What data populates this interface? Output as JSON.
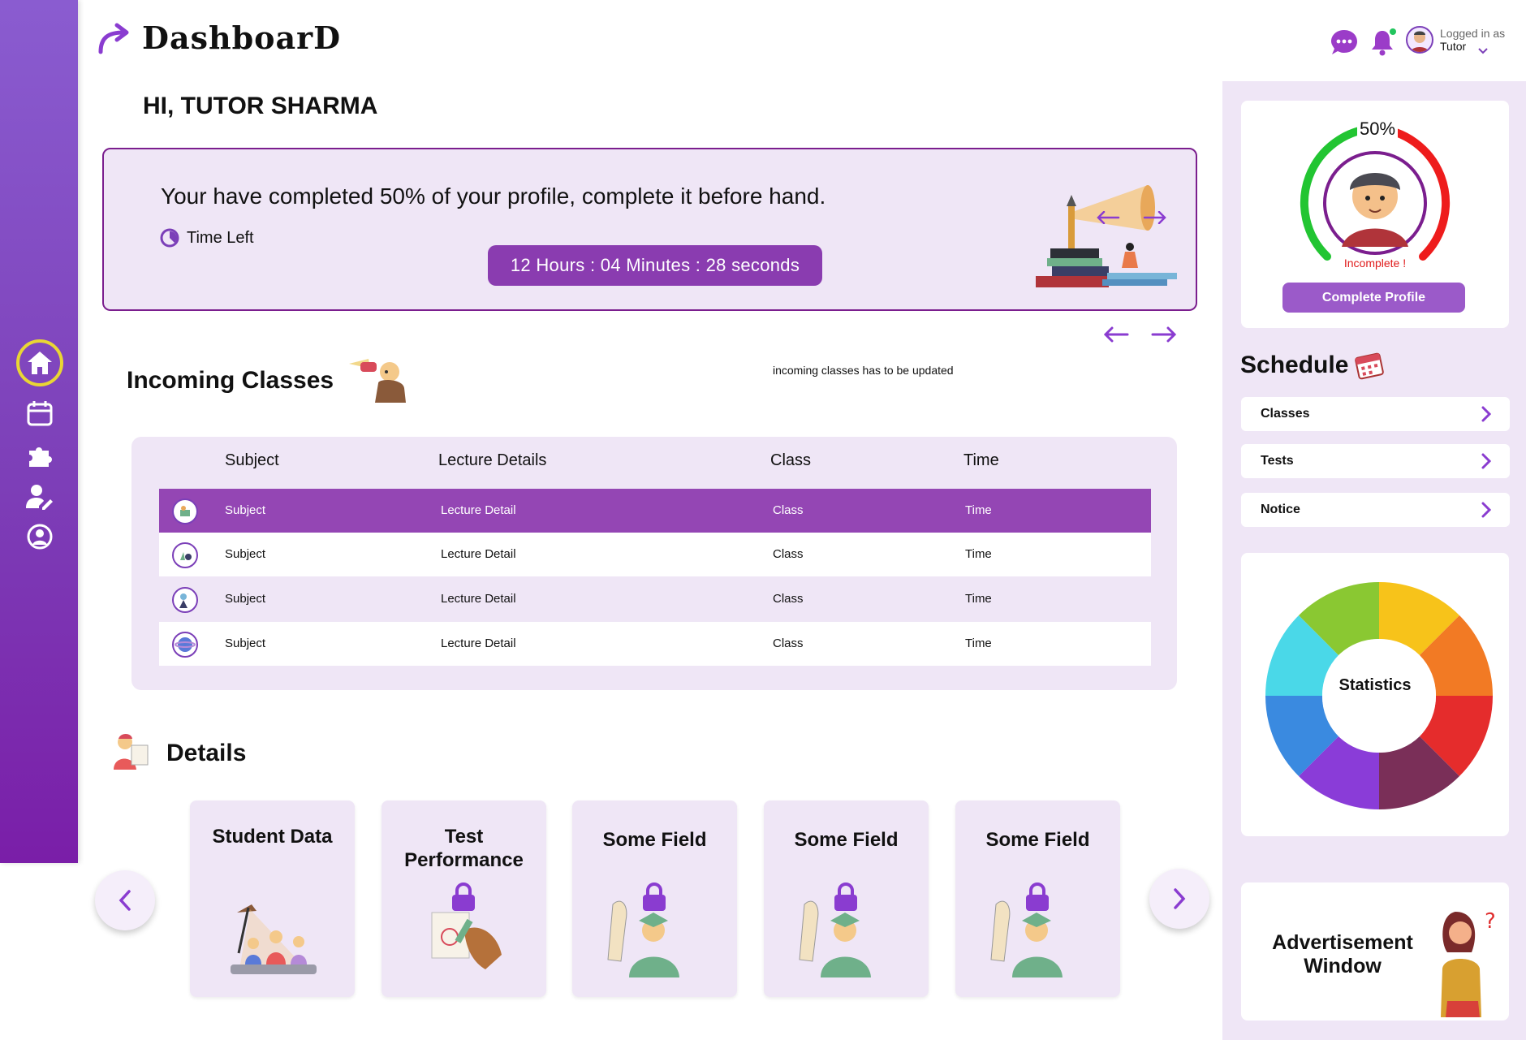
{
  "header": {
    "brand": "DashboarD",
    "greeting": "HI, TUTOR SHARMA",
    "user": {
      "logged_in_label": "Logged in as",
      "role": "Tutor"
    },
    "icons": [
      "chat-icon",
      "bell-icon",
      "user-avatar"
    ],
    "notification_dot_color": "#22c55e"
  },
  "sidebar": {
    "items": [
      {
        "name": "home",
        "icon": "home-icon",
        "active": true
      },
      {
        "name": "calendar",
        "icon": "calendar-icon"
      },
      {
        "name": "puzzle",
        "icon": "puzzle-icon"
      },
      {
        "name": "user-edit",
        "icon": "user-edit-icon"
      },
      {
        "name": "profile",
        "icon": "profile-icon"
      }
    ]
  },
  "banner": {
    "message": "Your have completed 50% of your profile, complete it before hand.",
    "time_left_label": "Time Left",
    "countdown": "12 Hours : 04 Minutes : 28 seconds"
  },
  "incoming": {
    "title": "Incoming Classes",
    "note": "incoming classes has to be updated",
    "columns": [
      "Subject",
      "Lecture Details",
      "Class",
      "Time"
    ],
    "rows": [
      {
        "subject": "Subject",
        "lecture": "Lecture Detail",
        "class": "Class",
        "time": "Time",
        "highlighted": true
      },
      {
        "subject": "Subject",
        "lecture": "Lecture Detail",
        "class": "Class",
        "time": "Time"
      },
      {
        "subject": "Subject",
        "lecture": "Lecture Detail",
        "class": "Class",
        "time": "Time"
      },
      {
        "subject": "Subject",
        "lecture": "Lecture Detail",
        "class": "Class",
        "time": "Time"
      }
    ]
  },
  "details": {
    "title": "Details",
    "cards": [
      {
        "title": "Student Data",
        "locked": false
      },
      {
        "title": "Test Performance",
        "locked": true
      },
      {
        "title": "Some Field",
        "locked": true
      },
      {
        "title": "Some Field",
        "locked": true
      },
      {
        "title": "Some Field",
        "locked": true
      }
    ]
  },
  "profile": {
    "percent_label": "50%",
    "percent": 50,
    "status": "Incomplete !",
    "button": "Complete Profile"
  },
  "schedule": {
    "title": "Schedule",
    "items": [
      "Classes",
      "Tests",
      "Notice"
    ]
  },
  "statistics": {
    "label": "Statistics"
  },
  "advertisement": {
    "line1": "Advertisement",
    "line2": "Window"
  },
  "colors": {
    "accent": "#8a3cb0",
    "sidebar_top": "#8a5cd0",
    "sidebar_bottom": "#7a1ea8",
    "panel": "#efe6f6"
  }
}
